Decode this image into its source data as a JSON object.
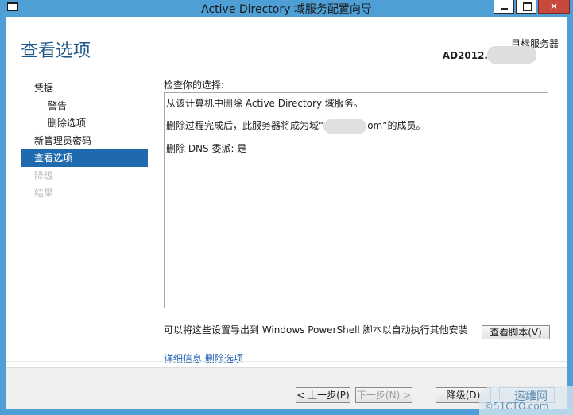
{
  "window": {
    "title": "Active Directory 域服务配置向导"
  },
  "header": {
    "page_title": "查看选项",
    "target_server_caption": "目标服务器",
    "target_server_name": "AD2012."
  },
  "nav": {
    "items": [
      {
        "label": "凭据",
        "state": "normal",
        "level": 0
      },
      {
        "label": "警告",
        "state": "normal",
        "level": 1
      },
      {
        "label": "删除选项",
        "state": "normal",
        "level": 1
      },
      {
        "label": "新管理员密码",
        "state": "normal",
        "level": 0
      },
      {
        "label": "查看选项",
        "state": "active",
        "level": 0
      },
      {
        "label": "降级",
        "state": "disabled",
        "level": 0
      },
      {
        "label": "结果",
        "state": "disabled",
        "level": 0
      }
    ]
  },
  "main": {
    "review_label": "检查你的选择:",
    "review_lines": {
      "line1": "从该计算机中删除 Active Directory 域服务。",
      "line2_prefix": "删除过程完成后，此服务器将成为域“",
      "line2_suffix": "om”的成员。",
      "line3": "删除 DNS 委派: 是"
    },
    "export_text": "可以将这些设置导出到 Windows PowerShell 脚本以自动执行其他安装",
    "view_script_button": "查看脚本(V)",
    "more_link": "详细信息 删除选项"
  },
  "footer": {
    "prev_button": "< 上一步(P)",
    "next_button": "下一步(N) >",
    "demote_button": "降级(D)",
    "cancel_button": "取消"
  },
  "watermark": {
    "top": "运维网",
    "bottom": "©51CTO.com"
  },
  "colors": {
    "window_frame": "#4d9fd6",
    "accent": "#1e6aad",
    "title_text": "#1f5a8c",
    "link": "#1f5fb4",
    "close_button": "#c7483c"
  }
}
